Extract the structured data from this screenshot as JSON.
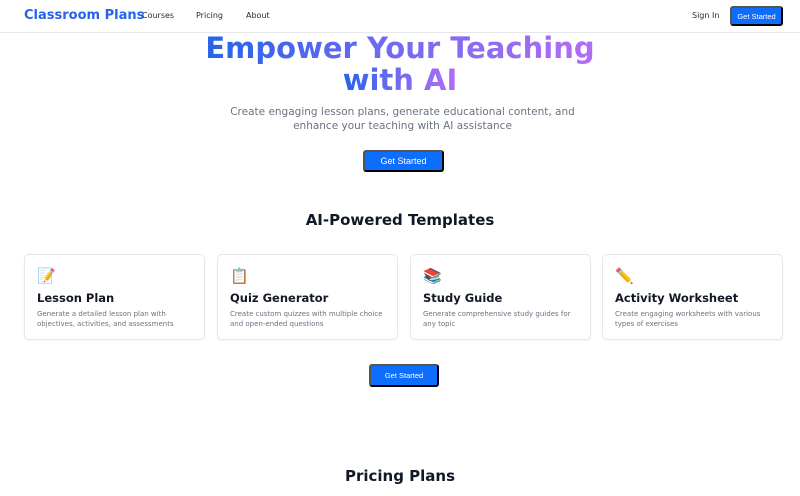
{
  "nav": {
    "brand": "Classroom Plans",
    "links": [
      "Courses",
      "Pricing",
      "About"
    ],
    "sign_in": "Sign In",
    "cta": "Get Started"
  },
  "hero": {
    "title_line1": "Empower Your Teaching",
    "title_line2": "with AI",
    "subtitle": "Create engaging lesson plans, generate educational content, and enhance your teaching with AI assistance",
    "cta": "Get Started"
  },
  "templates": {
    "heading": "AI-Powered Templates",
    "cards": [
      {
        "icon": "📝",
        "icon_name": "memo-icon",
        "title": "Lesson Plan",
        "description": "Generate a detailed lesson plan with objectives, activities, and assessments"
      },
      {
        "icon": "📋",
        "icon_name": "clipboard-icon",
        "title": "Quiz Generator",
        "description": "Create custom quizzes with multiple choice and open-ended questions"
      },
      {
        "icon": "📚",
        "icon_name": "books-icon",
        "title": "Study Guide",
        "description": "Generate comprehensive study guides for any topic"
      },
      {
        "icon": "✏️",
        "icon_name": "pencil-icon",
        "title": "Activity Worksheet",
        "description": "Create engaging worksheets with various types of exercises"
      }
    ],
    "cta": "Get Started"
  },
  "pricing": {
    "heading": "Pricing Plans"
  },
  "colors": {
    "primary": "#0d6efd",
    "brand": "#2563eb",
    "gradient_start": "#2563eb",
    "gradient_end": "#b36cf4"
  }
}
